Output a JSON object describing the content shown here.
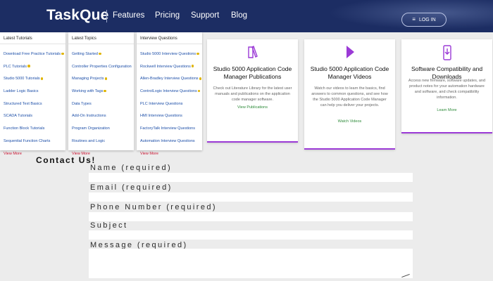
{
  "header": {
    "logo_prefix": "Task",
    "logo_mark": "Q",
    "logo_suffix": "ue",
    "nav": [
      "Features",
      "Pricing",
      "Support",
      "Blog"
    ],
    "login_label": "LOG IN"
  },
  "menu": [
    {
      "heading": "Latest Tutorials",
      "items": [
        "Download Free Practice Tutorials",
        "PLC Tutorials",
        "Studio 5000 Tutorials",
        "Ladder Logic Basics",
        "Structured Text Basics",
        "SCADA Tutorials",
        "Function Block Tutorials",
        "Sequential Function Charts",
        "View More"
      ]
    },
    {
      "heading": "Latest Topics",
      "items": [
        "Getting Started",
        "Controller Properties Configuration",
        "Managing Projects",
        "Working with Tags",
        "Data Types",
        "Add-On Instructions",
        "Program Organization",
        "Routines and Logic",
        "View More"
      ]
    },
    {
      "heading": "Interview Questions",
      "items": [
        "Studio 5000 Interview Questions",
        "Rockwell Interview Questions",
        "Allen-Bradley Interview Questions",
        "ControlLogix Interview Questions",
        "PLC Interview Questions",
        "HMI Interview Questions",
        "FactoryTalk Interview Questions",
        "Automation Interview Questions",
        "View More"
      ]
    }
  ],
  "cards": [
    {
      "title": "Studio 5000 Application Code Manager Publications",
      "desc": "Check out Literature Library for the latest user manuals and publications on the application code manager software.",
      "link": "View Publications"
    },
    {
      "title": "Studio 5000 Application Code Manager Videos",
      "desc": "Watch our videos to learn the basics, find answers to common questions, and see how the Studio 5000 Application Code Manager can help you deliver your projects.",
      "link": "Watch Videos"
    },
    {
      "title": "Software Compatibility and Downloads",
      "desc": "Access new firmware, software updates, and product notes for your automation hardware and software, and check compatibility information.",
      "link": "Learn More"
    }
  ],
  "contact": {
    "heading": "Contact Us!",
    "fields": [
      "Name (required)",
      "Email (required)",
      "Phone Number (required)",
      "Subject",
      "Message (required)"
    ]
  },
  "colors": {
    "header_bg": "#1c2d63",
    "card_accent": "#9b3ad6",
    "link_green": "#2e8b3a",
    "menu_link": "#1d4fa8",
    "view_more": "#c8102e"
  }
}
